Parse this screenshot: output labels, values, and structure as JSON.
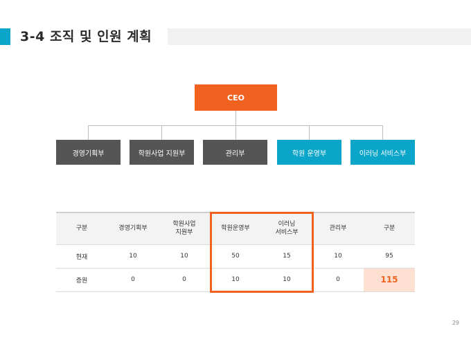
{
  "header": {
    "title": "3-4 조직 및 인원 계획"
  },
  "org_chart": {
    "root": "CEO",
    "departments": [
      {
        "label": "경영기획부"
      },
      {
        "label": "학원사업 지원부"
      },
      {
        "label": "관리부"
      },
      {
        "label": "학원 운영부"
      },
      {
        "label": "이러닝 서비스부"
      }
    ],
    "colors": {
      "root": "#f16120",
      "dark": "#555555",
      "blue": "#0aa5c9"
    }
  },
  "table": {
    "headers": [
      "구분",
      "경영기획부",
      "학원사업\n지원부",
      "학원운영부",
      "이러닝\n서비스부",
      "관리부",
      "구분"
    ],
    "rows": [
      [
        "현재",
        "10",
        "10",
        "50",
        "15",
        "10",
        "95"
      ],
      [
        "증원",
        "0",
        "0",
        "10",
        "10",
        "0",
        "115"
      ]
    ],
    "highlight_color": "#f16120"
  },
  "footer": {
    "page_number": "29"
  }
}
